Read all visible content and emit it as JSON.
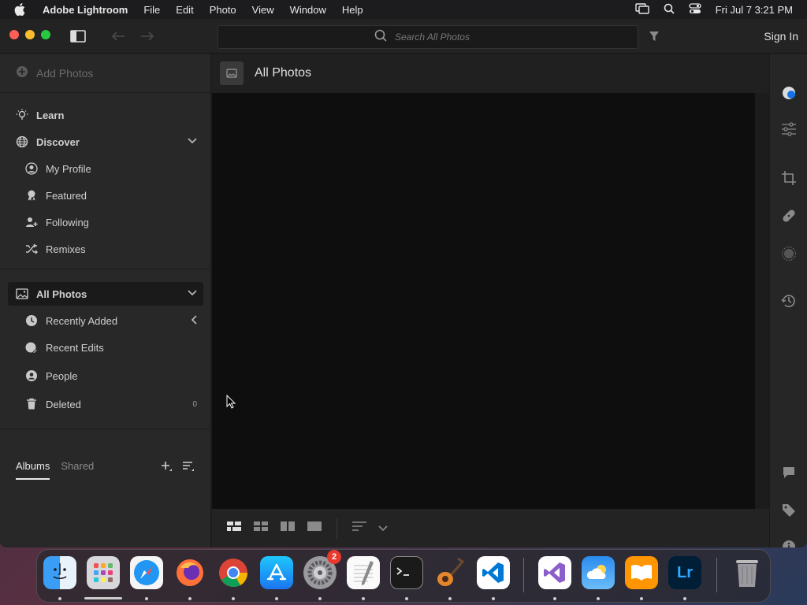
{
  "menubar": {
    "app_name": "Adobe Lightroom",
    "items": [
      "File",
      "Edit",
      "Photo",
      "View",
      "Window",
      "Help"
    ],
    "clock": "Fri Jul 7  3:21 PM"
  },
  "titlebar": {
    "search_placeholder": "Search All Photos",
    "sign_in": "Sign In"
  },
  "sidebar": {
    "add_photos": "Add Photos",
    "learn": "Learn",
    "discover": "Discover",
    "discover_items": [
      "My Profile",
      "Featured",
      "Following",
      "Remixes"
    ],
    "all_photos": "All Photos",
    "all_photos_items": [
      "Recently Added",
      "Recent Edits",
      "People",
      "Deleted"
    ],
    "deleted_count": "0",
    "tabs": {
      "albums": "Albums",
      "shared": "Shared"
    }
  },
  "main": {
    "title": "All Photos"
  },
  "dock": {
    "apps": [
      "Finder",
      "Launchpad",
      "Safari",
      "Firefox",
      "Chrome",
      "App Store",
      "System Settings",
      "TextEdit",
      "Terminal",
      "GarageBand",
      "VS Code",
      "Visual Studio",
      "Weather",
      "Books",
      "Lightroom",
      "Trash"
    ],
    "settings_badge": "2",
    "lightroom_label": "Lr"
  },
  "colors": {
    "accent": "#1473e6",
    "lightroom_bg": "#001e36",
    "lightroom_fg": "#31a8ff"
  }
}
